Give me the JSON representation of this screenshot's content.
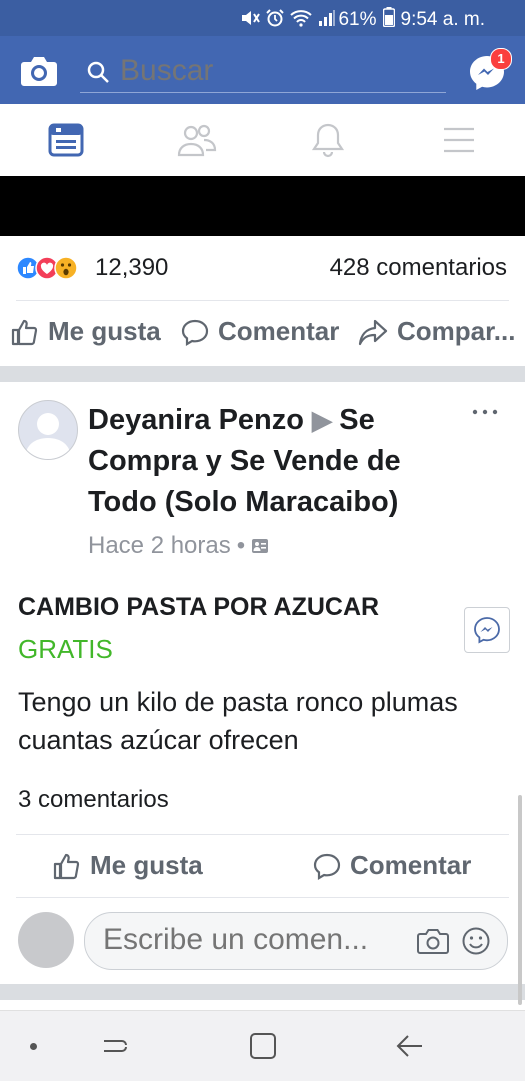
{
  "status_bar": {
    "battery": "61%",
    "time": "9:54 a. m."
  },
  "header": {
    "search_placeholder": "Buscar",
    "messenger_badge": "1"
  },
  "tabs": [
    {
      "icon": "news-feed-icon",
      "active": true
    },
    {
      "icon": "friends-icon",
      "active": false
    },
    {
      "icon": "notifications-bell-icon",
      "active": false
    },
    {
      "icon": "menu-icon",
      "active": false
    }
  ],
  "previous_post": {
    "reaction_count": "12,390",
    "comments": "428 comentarios",
    "actions": {
      "like": "Me gusta",
      "comment": "Comentar",
      "share": "Compar..."
    }
  },
  "post": {
    "author": "Deyanira Penzo",
    "group": "Se Compra y Se Vende de Todo (Solo Maracaibo)",
    "time": "Hace 2 horas",
    "title": "CAMBIO PASTA POR AZUCAR",
    "price": "GRATIS",
    "body": "Tengo un kilo de pasta ronco plumas cuantas azúcar ofrecen",
    "comment_count": "3 comentarios",
    "actions": {
      "like": "Me gusta",
      "comment": "Comentar"
    },
    "comment_placeholder": "Escribe un comen..."
  },
  "colors": {
    "brand_blue": "#4267b2",
    "price_green": "#42b72a",
    "text": "#1c1e21",
    "muted": "#606770"
  }
}
